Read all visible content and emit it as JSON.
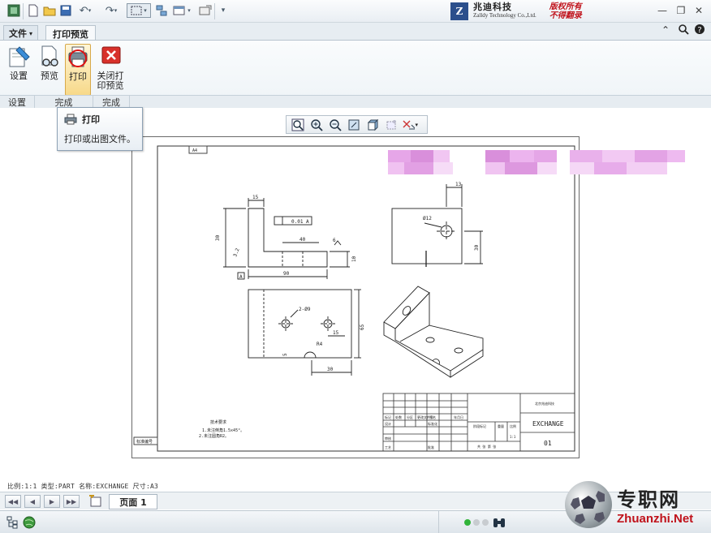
{
  "toolbar": {
    "icons": [
      "window-icon",
      "new-file-icon",
      "open-folder-icon",
      "save-icon",
      "undo-icon",
      "redo-icon",
      "select-box-icon",
      "regenerate-icon",
      "windows-icon",
      "close-window-icon",
      "customize-icon"
    ]
  },
  "brand": {
    "company_cn": "兆迪科技",
    "company_en": "Zalldy Technology Co.,Ltd.",
    "copyright_line1": "版权所有",
    "copyright_line2": "不得翻录"
  },
  "tabs": {
    "file": "文件",
    "print_preview": "打印预览"
  },
  "ribbon": {
    "buttons": {
      "settings": "设置",
      "preview": "预览",
      "print": "打印",
      "close_preview_line1": "关闭打",
      "close_preview_line2": "印预览"
    },
    "groups": {
      "settings": "设置",
      "finish1": "完成",
      "finish2": "完成"
    }
  },
  "tooltip": {
    "title": "打印",
    "description": "打印或出图文件。"
  },
  "drawing": {
    "dims": {
      "d15": "15",
      "d40": "40",
      "d90": "90",
      "d30": "30",
      "d10": "10",
      "d6": "6",
      "tol": "0.01",
      "datum": "A",
      "rough": "3.2",
      "d13": "13",
      "phi12": "Ø12",
      "d30b": "30",
      "holes": "2-Ø9",
      "d15b": "15",
      "r4": "R4",
      "d65": "65",
      "d5": "5",
      "d30c": "30"
    },
    "notes_title": "技术要求",
    "notes_line1": "1.未注倒角1.5x45°。",
    "notes_line2": "2.未注圆角R2。",
    "corner_label": "A4",
    "left_label": "标准编号",
    "title_block": {
      "part_name": "EXCHANGE",
      "part_no": "01",
      "header": "北京兆迪科技",
      "scale": "1:1",
      "cells": [
        "标记",
        "处数",
        "分区",
        "更改文件号",
        "签名",
        "年月日",
        "设计",
        "标准化",
        "审核",
        "工艺",
        "批准",
        "阶段标记",
        "重量",
        "比例",
        "共 张 第 张"
      ]
    }
  },
  "status": {
    "text": "比例:1:1    类型:PART    名称:EXCHANGE    尺寸:A3"
  },
  "pagebar": {
    "page_label": "页面 1"
  },
  "watermark": {
    "cn": "专职网",
    "en": "Zhuanzhi.Net"
  }
}
